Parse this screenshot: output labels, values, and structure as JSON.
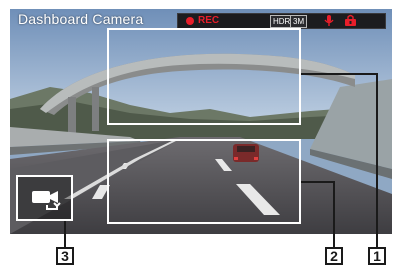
{
  "app": {
    "title": "Dashboard Camera"
  },
  "status_bar": {
    "rec_label": "REC",
    "hdr_label": "HDR",
    "resolution_label": "3M",
    "icons": [
      "microphone-icon",
      "camera-lock-icon"
    ],
    "rec_color": "#e81e2a"
  },
  "controls": {
    "camera_switch_icon": "camera-switch-icon"
  },
  "callouts": {
    "one": "1",
    "two": "2",
    "three": "3"
  }
}
